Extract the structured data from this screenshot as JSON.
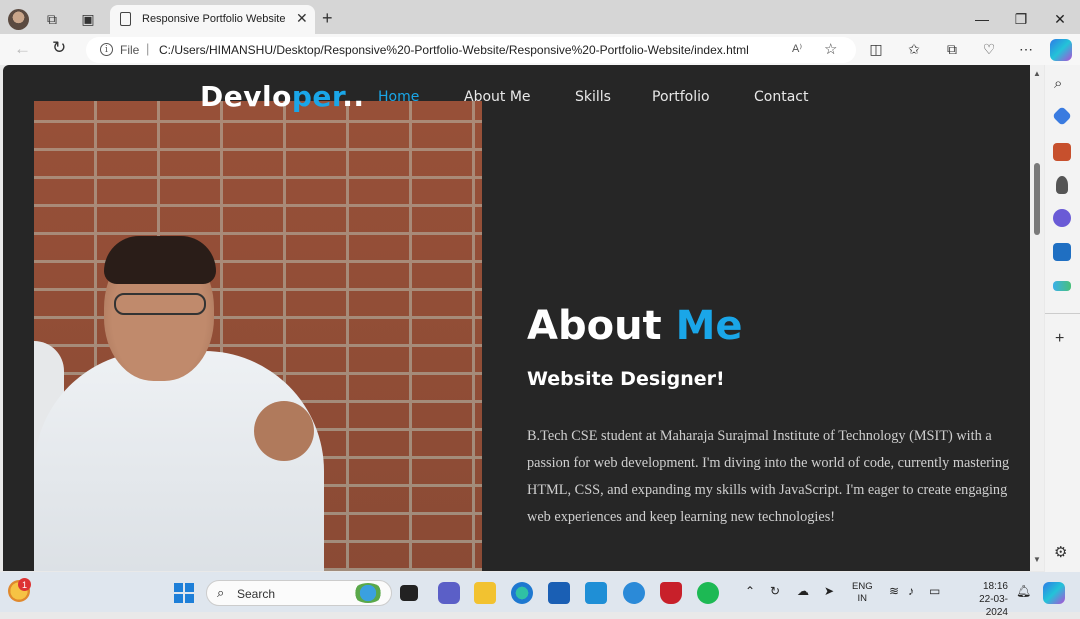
{
  "browser": {
    "tab_title": "Responsive Portfolio Website",
    "file_label": "File",
    "url": "C:/Users/HIMANSHU/Desktop/Responsive%20-Portfolio-Website/Responsive%20-Portfolio-Website/index.html",
    "read_aloud": "A⁾"
  },
  "site": {
    "logo_a": "Devlo",
    "logo_b": "per",
    "logo_c": "..",
    "nav": {
      "home": "Home",
      "about": "About Me",
      "skills": "Skills",
      "portfolio": "Portfolio",
      "contact": "Contact"
    },
    "about": {
      "heading_a": "About ",
      "heading_b": "Me",
      "subheading": "Website Designer!",
      "body": "B.Tech CSE student at Maharaja Surajmal Institute of Technology (MSIT) with a passion for web development. I'm diving into the world of code, currently mastering HTML, CSS, and expanding my skills with JavaScript. I'm eager to create engaging web experiences and keep learning new technologies!"
    }
  },
  "taskbar": {
    "weather_badge": "1",
    "search_label": "Search",
    "lang_line1": "ENG",
    "lang_line2": "IN",
    "time": "18:16",
    "date": "22-03-2024"
  },
  "colors": {
    "accent": "#1aa6e8",
    "page_bg": "#262626"
  }
}
